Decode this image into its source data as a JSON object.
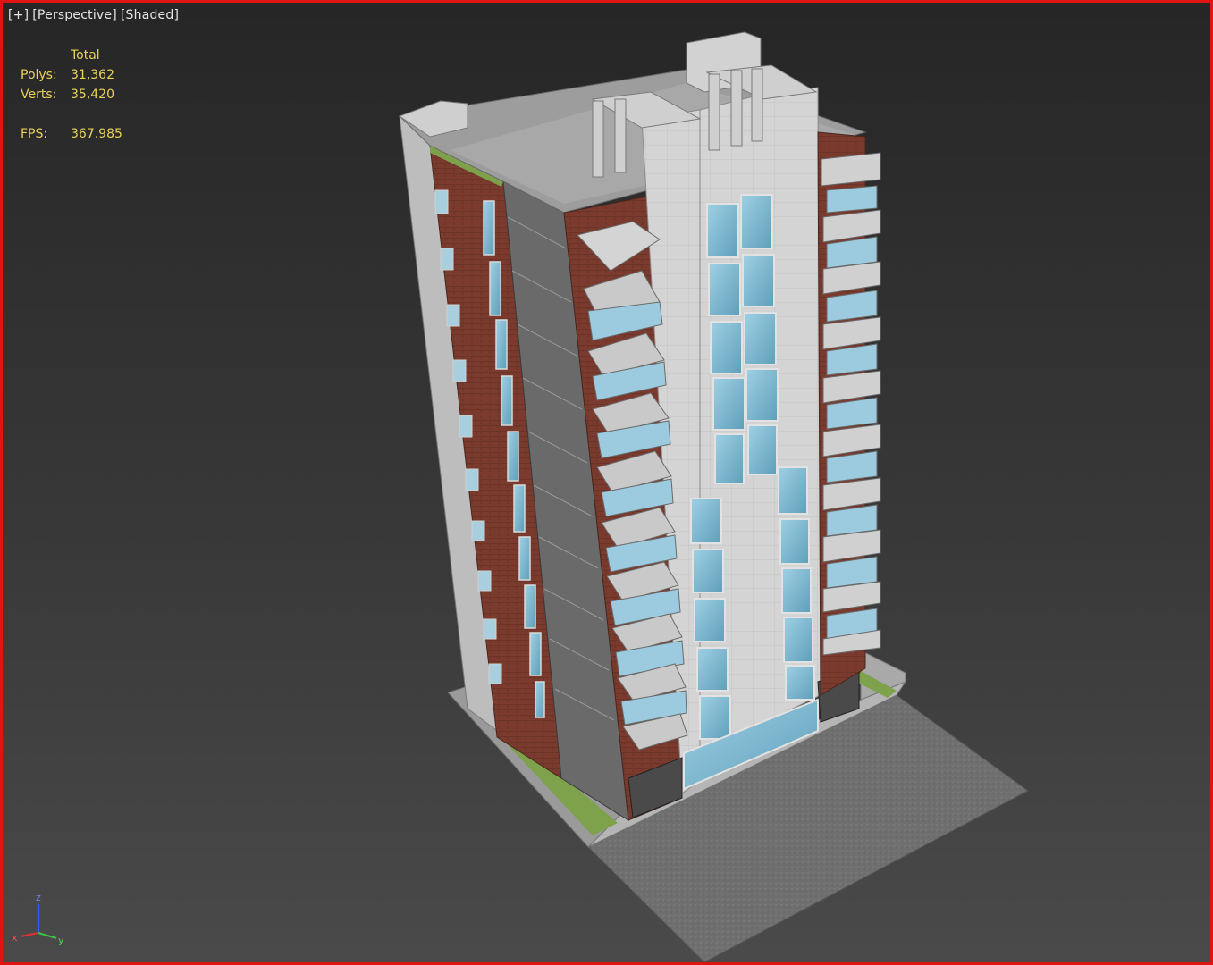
{
  "viewport": {
    "label_plus": "[+]",
    "label_view": "[Perspective]",
    "label_mode": "[Shaded]",
    "border_color": "#e11414"
  },
  "stats": {
    "header": "Total",
    "polys_label": "Polys:",
    "polys_value": "31,362",
    "verts_label": "Verts:",
    "verts_value": "35,420",
    "fps_label": "FPS:",
    "fps_value": "367.985",
    "text_color": "#e8d25a"
  },
  "axis": {
    "x": "x",
    "y": "y",
    "z": "z"
  },
  "model": {
    "name": "high-rise-apartment-building",
    "colors": {
      "concrete": "#d8d8d8",
      "brick": "#7a3b2e",
      "glass": "#7fb9d1",
      "ground": "#6e6e6e",
      "grass": "#7da24b"
    }
  }
}
